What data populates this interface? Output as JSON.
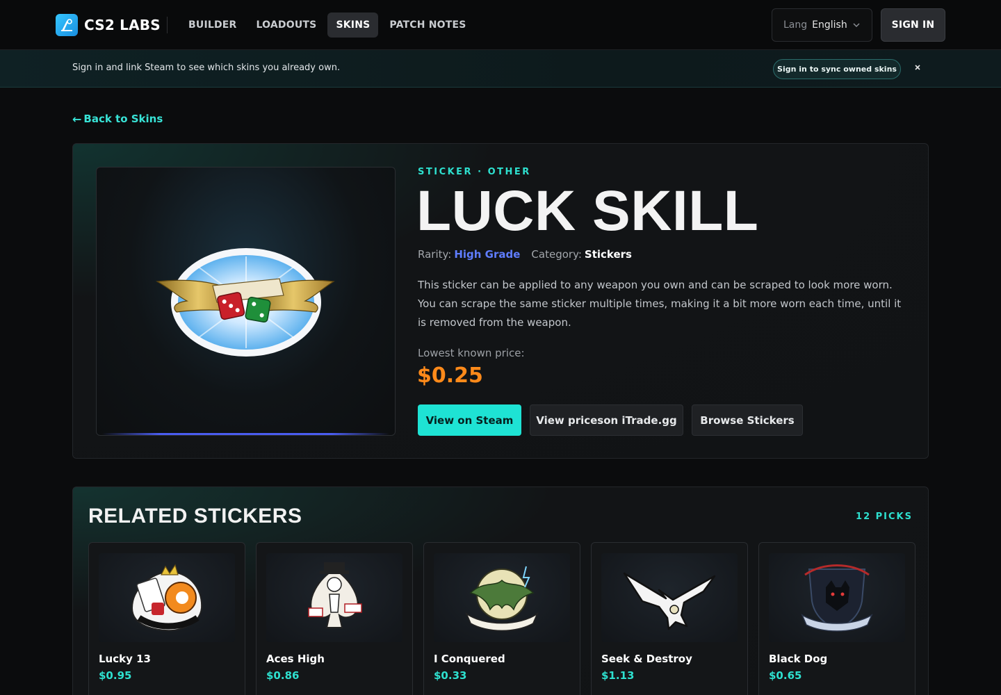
{
  "header": {
    "logo_text": "CS2 LABS",
    "nav": [
      {
        "label": "BUILDER",
        "active": false
      },
      {
        "label": "LOADOUTS",
        "active": false
      },
      {
        "label": "SKINS",
        "active": true
      },
      {
        "label": "PATCH NOTES",
        "active": false
      }
    ],
    "lang_label": "Lang",
    "lang_value": "English",
    "sign_in": "SIGN IN"
  },
  "banner": {
    "text": "Sign in and link Steam to see which skins you already own.",
    "button": "Sign in to sync owned skins",
    "close": "×"
  },
  "back": {
    "arrow": "←",
    "label": "Back to Skins"
  },
  "item": {
    "kicker": "STICKER · OTHER",
    "title": "LUCK SKILL",
    "rarity_label": "Rarity:",
    "rarity": "High Grade",
    "category_label": "Category:",
    "category": "Stickers",
    "description": "This sticker can be applied to any weapon you own and can be scraped to look more worn. You can scrape the same sticker multiple times, making it a bit more worn each time, until it is removed from the weapon.",
    "price_label": "Lowest known price:",
    "price": "$0.25",
    "buttons": {
      "steam": "View on Steam",
      "itrade": "View priceson iTrade.gg",
      "browse": "Browse Stickers"
    }
  },
  "related": {
    "title": "RELATED STICKERS",
    "count": "12 PICKS",
    "items": [
      {
        "name": "Lucky 13",
        "price": "$0.95",
        "icon": "lucky-thirteen-sticker"
      },
      {
        "name": "Aces High",
        "price": "$0.86",
        "icon": "aces-high-sticker"
      },
      {
        "name": "I Conquered",
        "price": "$0.33",
        "icon": "i-conquered-sticker"
      },
      {
        "name": "Seek & Destroy",
        "price": "$1.13",
        "icon": "seek-destroy-sticker"
      },
      {
        "name": "Black Dog",
        "price": "$0.65",
        "icon": "black-dog-sticker"
      }
    ]
  },
  "colors": {
    "accent": "#1ee3d4",
    "price": "#ff8a1a",
    "rarity": "#5f7dff"
  }
}
